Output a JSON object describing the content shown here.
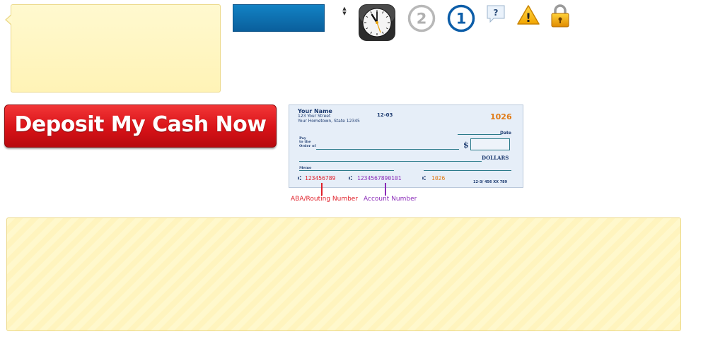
{
  "deposit_button": {
    "label": "Deposit My Cash Now"
  },
  "icons": {
    "clock": "clock-icon",
    "number_two": "2",
    "number_one": "1",
    "help": "?",
    "warning": "!",
    "lock": "lock-icon"
  },
  "colors": {
    "deposit_red": "#d81217",
    "blue_button": "#0a6aab",
    "tooltip_yellow": "#fff6c2",
    "routing_red": "#e0202a",
    "account_purple": "#8a2bb8",
    "check_number_orange": "#e07a16"
  },
  "check": {
    "name": "Your Name",
    "street": "123 Your Street",
    "city": "Your Hometown, State 12345",
    "fraction": "12-03",
    "number": "1026",
    "date_label": "Date",
    "pay_label_1": "Pay",
    "pay_label_2": "to the",
    "pay_label_3": "Order of",
    "dollar_sign": "$",
    "dollars_label": "DOLLARS",
    "memo_label": "Memo",
    "routing_number": "123456789",
    "account_number": "1234567890101",
    "check_number_micr": "1026",
    "bottom_code": "12-3/ 456 XX 789",
    "routing_caption": "ABA/Routing Number",
    "account_caption": "Account Number"
  }
}
